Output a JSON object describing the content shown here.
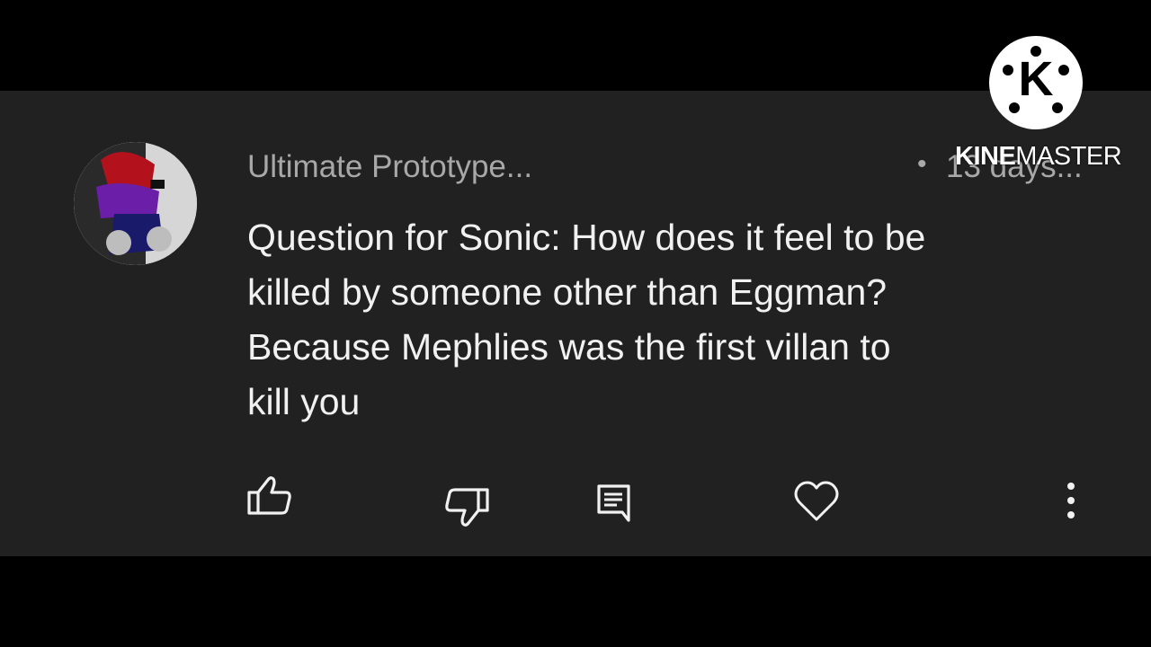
{
  "comment": {
    "author": "Ultimate Prototype...",
    "separator": "•",
    "time": "13 days...",
    "text": "Question for Sonic: How does it feel to be\nkilled by someone other than Eggman?\nBecause Mephlies was the first villan to\nkill you"
  },
  "actions": {
    "like_icon": "thumbs-up-icon",
    "dislike_icon": "thumbs-down-icon",
    "reply_icon": "comment-icon",
    "heart_icon": "heart-icon",
    "more_icon": "more-vertical-icon"
  },
  "watermark": {
    "logo_letter": "K",
    "brand_bold": "KINE",
    "brand_rest": "MASTER"
  },
  "colors": {
    "background": "#000000",
    "card": "#212121",
    "text_primary": "#f1f1f1",
    "text_secondary": "#a8a8a8"
  }
}
